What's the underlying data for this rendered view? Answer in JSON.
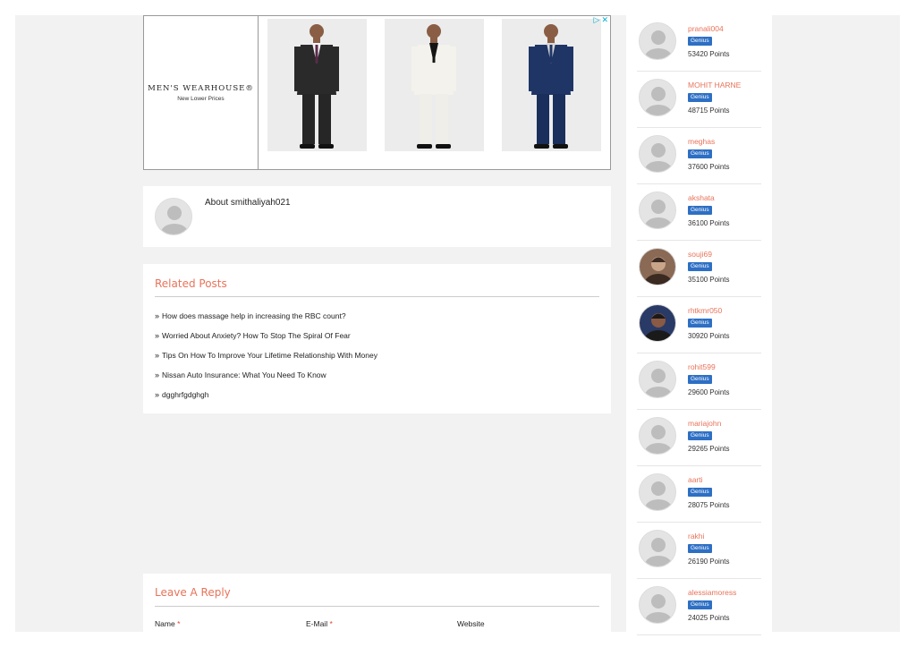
{
  "ad": {
    "brand_name": "MEN'S WEARHOUSE®",
    "brand_tagline": "New Lower Prices",
    "ad_choices_icon": "ad-choices-icon",
    "close_icon": "close-icon",
    "suits": [
      {
        "jacket": "#2a2a2a",
        "trousers": "#262626",
        "shirt": "#f5f5f5",
        "tie": "#5a2a4a"
      },
      {
        "jacket": "#f4f2ec",
        "trousers": "#f0eee8",
        "shirt": "#151515",
        "tie": "#151515"
      },
      {
        "jacket": "#1f3566",
        "trousers": "#1b2f5c",
        "shirt": "#d9d9d9",
        "tie": "#1f3566"
      }
    ]
  },
  "about": {
    "text": "About smithaliyah021"
  },
  "related": {
    "title": "Related Posts",
    "posts": [
      "How does massage help in increasing the RBC count?",
      "Worried About Anxiety? How To Stop The Spiral Of Fear",
      "Tips On How To Improve Your Lifetime Relationship With Money",
      "Nissan Auto Insurance: What You Need To Know",
      "dgghrfgdghgh"
    ]
  },
  "reply": {
    "title": "Leave A Reply",
    "name_label": "Name",
    "email_label": "E-Mail",
    "website_label": "Website",
    "required_mark": "*"
  },
  "leaderboard": {
    "points_suffix": "Points",
    "users": [
      {
        "name": "pranali004",
        "badge": "Genius",
        "points": "53420",
        "avatar": "default"
      },
      {
        "name": "MOHIT HARNE",
        "badge": "Genius",
        "points": "48715",
        "avatar": "default"
      },
      {
        "name": "meghas",
        "badge": "Genius",
        "points": "37600",
        "avatar": "default"
      },
      {
        "name": "akshata",
        "badge": "Genius",
        "points": "36100",
        "avatar": "default"
      },
      {
        "name": "souji69",
        "badge": "Genius",
        "points": "35100",
        "avatar": "photo"
      },
      {
        "name": "rhtkmr050",
        "badge": "Genius",
        "points": "30920",
        "avatar": "photo"
      },
      {
        "name": "rohit599",
        "badge": "Genius",
        "points": "29600",
        "avatar": "default"
      },
      {
        "name": "mariajohn",
        "badge": "Genius",
        "points": "29265",
        "avatar": "default"
      },
      {
        "name": "aarti",
        "badge": "Genius",
        "points": "28075",
        "avatar": "default"
      },
      {
        "name": "rakhi",
        "badge": "Genius",
        "points": "26190",
        "avatar": "default"
      },
      {
        "name": "alessiamoress",
        "badge": "Genius",
        "points": "24025",
        "avatar": "default"
      }
    ]
  },
  "colors": {
    "accent": "#e8735a",
    "badge": "#2d6fc4",
    "background": "#f2f2f2"
  }
}
